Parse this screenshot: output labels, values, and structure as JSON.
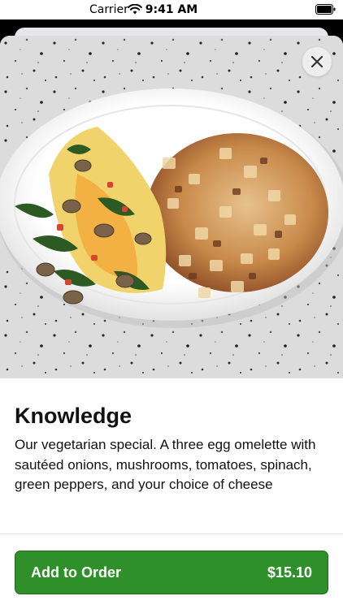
{
  "status_bar": {
    "carrier": "Carrier",
    "time": "9:41 AM"
  },
  "item": {
    "title": "Knowledge",
    "description": "Our vegetarian special. A three egg omelette with sautéed onions, mushrooms, tomatoes, spinach, green peppers, and your choice of cheese",
    "add_button_label": "Add to Order",
    "price": "$15.10"
  },
  "colors": {
    "accent": "#2f8f2a",
    "close_button_bg": "#eeeeee"
  },
  "icons": {
    "close": "close-icon",
    "wifi": "wifi-icon",
    "battery": "battery-icon"
  }
}
